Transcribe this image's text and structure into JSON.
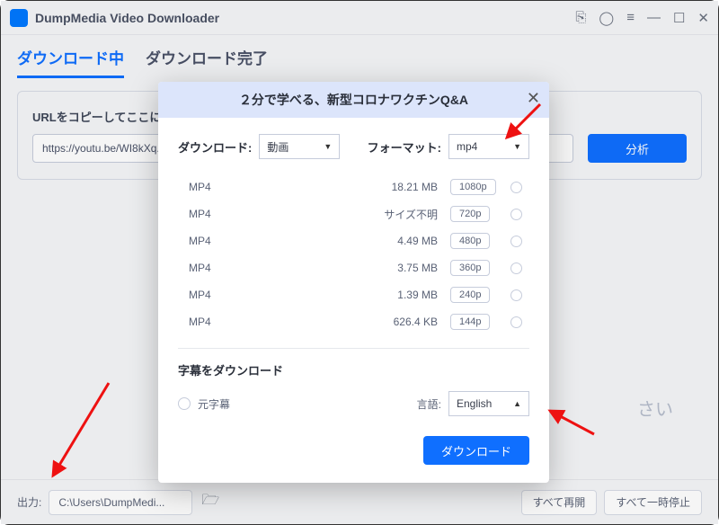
{
  "app": {
    "title": "DumpMedia Video Downloader"
  },
  "tabs": {
    "active": "ダウンロード中",
    "inactive": "ダウンロード完了"
  },
  "urlarea": {
    "label": "URLをコピーしてここに貼り付けください",
    "value": "https://youtu.be/WI8kXq...",
    "analyze": "分析"
  },
  "bgtext": "さい",
  "footer": {
    "label": "出力:",
    "path": "C:\\Users\\DumpMedi...",
    "resume": "すべて再開",
    "pause": "すべて一時停止"
  },
  "modal": {
    "title": "２分で学べる、新型コロナワクチンQ&A",
    "download_label": "ダウンロード:",
    "download_sel": "動画",
    "format_label": "フォーマット:",
    "format_sel": "mp4",
    "rows": [
      {
        "fmt": "MP4",
        "size": "18.21 MB",
        "res": "1080p"
      },
      {
        "fmt": "MP4",
        "size": "サイズ不明",
        "res": "720p"
      },
      {
        "fmt": "MP4",
        "size": "4.49 MB",
        "res": "480p"
      },
      {
        "fmt": "MP4",
        "size": "3.75 MB",
        "res": "360p"
      },
      {
        "fmt": "MP4",
        "size": "1.39 MB",
        "res": "240p"
      },
      {
        "fmt": "MP4",
        "size": "626.4 KB",
        "res": "144p"
      }
    ],
    "subtitle_hdr": "字幕をダウンロード",
    "subtitle_opt": "元字幕",
    "lang_label": "言語:",
    "lang_sel": "English",
    "dl_button": "ダウンロード"
  }
}
